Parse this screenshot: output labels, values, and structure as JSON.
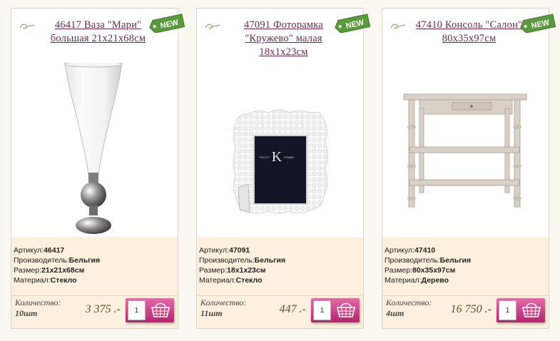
{
  "products": [
    {
      "title": "46417 Ваза \"Мари\" большая 21x21x68см",
      "badge": "NEW",
      "article_label": "Артикул:",
      "article": "46417",
      "maker_label": "Производитель:",
      "maker": "Бельгия",
      "size_label": "Размер:",
      "size": "21x21x68см",
      "material_label": "Материал:",
      "material": "Стекло",
      "qty_label": "Количество:",
      "stock": "10шт",
      "price": "3 375 .-",
      "qty_value": "1"
    },
    {
      "title": "47091 Фоторамка \"Кружево\" малая 18x1x23см",
      "badge": "NEW",
      "article_label": "Артикул:",
      "article": "47091",
      "maker_label": "Производитель:",
      "maker": "Бельгия",
      "size_label": "Размер:",
      "size": "18x1x23см",
      "material_label": "Материал:",
      "material": "Стекло",
      "qty_label": "Количество:",
      "stock": "11шт",
      "price": "447 .-",
      "qty_value": "1"
    },
    {
      "title": "47410 Консоль \"Салон\" 80x35x97см",
      "badge": "NEW",
      "article_label": "Артикул:",
      "article": "47410",
      "maker_label": "Производитель:",
      "maker": "Бельгия",
      "size_label": "Размер:",
      "size": "80x35x97см",
      "material_label": "Материал:",
      "material": "Дерево",
      "qty_label": "Количество:",
      "stock": "4шт",
      "price": "16 750 .-",
      "qty_value": "1"
    }
  ],
  "photo_texts": {
    "frame_letter": "K",
    "frame_left": "PHOTO",
    "frame_right": "FRAME"
  },
  "icons": {
    "swirl": "swirl-ornament-icon",
    "cart": "basket-icon",
    "badge": "new-tag-badge"
  },
  "colors": {
    "title": "#6b2a52",
    "badge": "#5a9a3c",
    "buy_button": "#c9307f",
    "spec_bg": "#fdf0de"
  }
}
